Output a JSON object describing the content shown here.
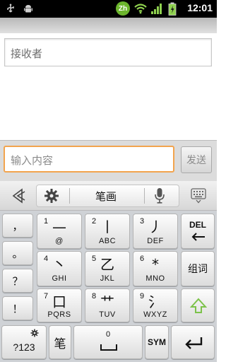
{
  "status_bar": {
    "clock": "12:01",
    "ime_badge": "Zh",
    "icons": [
      "usb-icon",
      "android-debug-icon",
      "wifi-icon",
      "signal-icon",
      "battery-charging-icon"
    ]
  },
  "recipient": {
    "placeholder": "接收者"
  },
  "compose": {
    "placeholder": "输入内容",
    "send_label": "发送"
  },
  "keyboard": {
    "toolbar": {
      "mode_label": "笔画",
      "icons": [
        "collapse-keyboard-icon",
        "settings-gear-icon",
        "microphone-icon",
        "keyboard-layout-icon"
      ]
    },
    "punct_keys": [
      "，",
      "。",
      "？",
      "！"
    ],
    "grid_keys": [
      {
        "num": "1",
        "sym": "—",
        "letters": "@"
      },
      {
        "num": "2",
        "sym": "丨",
        "letters": "ABC"
      },
      {
        "num": "3",
        "sym": "丿",
        "letters": "DEF"
      },
      {
        "num": "4",
        "sym": "丶",
        "letters": "GHI"
      },
      {
        "num": "5",
        "sym": "乙",
        "letters": "JKL"
      },
      {
        "num": "6",
        "sym": "*",
        "letters": "MNO"
      },
      {
        "num": "7",
        "sym": "口",
        "letters": "PQRS"
      },
      {
        "num": "8",
        "sym": "艹",
        "letters": "TUV"
      },
      {
        "num": "9",
        "sym": "氵",
        "letters": "WXYZ"
      }
    ],
    "del_label": "DEL",
    "compose_word_label": "组词",
    "bottom_row": {
      "num_mode": "?123",
      "stroke": "笔",
      "space_num": "0",
      "sym": "SYM"
    }
  },
  "colors": {
    "focus_border": "#f2a44e",
    "shift_arrow": "#7cc24a",
    "ime_badge": "#6cb52d"
  }
}
